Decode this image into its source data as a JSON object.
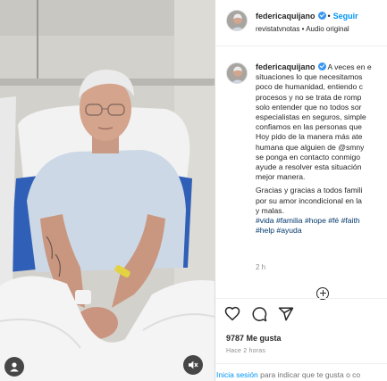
{
  "post": {
    "username": "federicaquijano",
    "follow_label": "Seguir",
    "dot_separator": "•",
    "audio_account": "revistatvnotas",
    "audio_label": "Audio original",
    "caption_lines": [
      "A veces en e",
      "situaciones lo que necesitamos",
      "poco de humanidad, entiendo c",
      "procesos y no se trata de romp",
      "solo entender que no todos sor",
      "especialistas en seguros, simple",
      "confiamos en las personas que",
      "Hoy pido de la manera más ate",
      "humana que alguien de @smny",
      "se ponga en contacto conmigo",
      "ayude a resolver esta situación",
      "mejor manera."
    ],
    "caption_lines_2": [
      "Gracias y gracias a todos famili",
      "por su amor incondicional en la",
      "y malas."
    ],
    "hashtags_line1": [
      "#vida",
      "#familia",
      "#hope",
      "#fé",
      "#faith"
    ],
    "hashtags_line2": [
      "#help",
      "#ayuda"
    ],
    "time_posted": "2 h",
    "likes_text": "9787 Me gusta",
    "time_ago": "Hace 2 horas",
    "login_link": "Inicia sesión",
    "login_rest": "para indicar que te gusta o co"
  },
  "icons": {
    "verified": "verified-badge-icon",
    "more": "more-options-icon",
    "like": "heart-icon",
    "comment": "comment-icon",
    "share": "share-icon",
    "user": "user-icon",
    "mute": "mute-icon"
  },
  "colors": {
    "link_blue": "#0095f6",
    "hashtag_blue": "#00376b",
    "verified_blue": "#3897f0",
    "text": "#262626",
    "muted": "#8e8e8e"
  }
}
